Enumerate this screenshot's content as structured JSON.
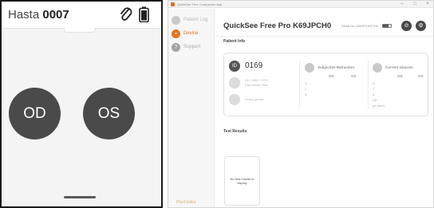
{
  "device": {
    "title_prefix": "Hasta",
    "patient_number": "0007",
    "od_label": "OD",
    "os_label": "OS"
  },
  "app": {
    "window_title": "QuickSee Free Companion App",
    "window_controls": {
      "minimize": "–",
      "maximize": "□",
      "close": "×"
    },
    "sidebar": {
      "items": [
        {
          "label": "Patient Log",
          "icon": "patient-log-icon",
          "active": false
        },
        {
          "label": "Device",
          "icon": "device-icon",
          "active": true
        },
        {
          "label": "Support",
          "icon": "support-icon",
          "active": false
        }
      ],
      "brand": "PlenOptika"
    },
    "header": {
      "product_title": "QuickSee Free Pro K69JPCH0",
      "serial": "Serial no. K69JPCH0",
      "battery_percent": "74%",
      "battery_level": 0.74
    },
    "patient_info": {
      "heading": "Patient Info",
      "patient_id": "0169",
      "id_badge": "ID",
      "dob_format": "DD / MM / YYYY",
      "dob_parts": "Day   Month   Year",
      "gender_placeholder": "Select gender",
      "subjective_refraction": {
        "title": "Subjective Refraction",
        "col_od": "OD",
        "col_os": "OS",
        "rows": [
          "S",
          "C",
          "A"
        ]
      },
      "current_glasses": {
        "title": "Current Glasses",
        "col_od": "OD",
        "col_os": "OS",
        "rows": [
          "S",
          "C",
          "A",
          "DD",
          "pd (mm)"
        ]
      }
    },
    "test_results": {
      "heading": "Test Results",
      "empty_message": "No test results to display"
    }
  },
  "colors": {
    "accent": "#e67321",
    "dark_button": "#4a4a4a",
    "sidebar_bg": "#f7f7f7"
  }
}
